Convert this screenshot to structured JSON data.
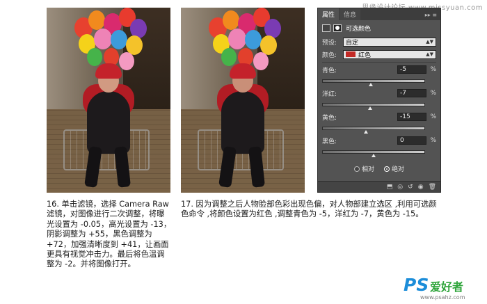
{
  "watermark_top": "思缘设计论坛 www.missyuan.com",
  "panel": {
    "tabs": [
      "属性",
      "信息"
    ],
    "tab_tools": "▸▸ ≡",
    "title": "可选颜色",
    "preset_label": "预设:",
    "preset_value": "自定",
    "colors_label": "颜色:",
    "colors_value": "红色",
    "colors_swatch": "#c32a26",
    "sliders": [
      {
        "name": "青色:",
        "value": "-5",
        "unit": "%",
        "level": -5
      },
      {
        "name": "洋红:",
        "value": "-7",
        "unit": "%",
        "level": -7
      },
      {
        "name": "黄色:",
        "value": "-15",
        "unit": "%",
        "level": -15
      },
      {
        "name": "黑色:",
        "value": "0",
        "unit": "%",
        "level": 0
      }
    ],
    "method_relative": "相对",
    "method_absolute": "绝对",
    "method_selected": "absolute"
  },
  "captions": {
    "left": "16. 单击滤镜，选择 Camera Raw 滤镜，对图像进行二次调整，将曝光设置为 -0.05，高光设置为 -13，阴影调整为 +55，黑色调整为 +72，加强清晰度到 +41，让画面更具有视觉冲击力。最后将色温调整为 -2。并将图像打开。",
    "right": "17. 因为调整之后人物脸部色彩出现色偏，对人物部建立选区 ,利用可选颜色命令 ,将颜色设置为红色 ,调整青色为 -5，洋红为 -7，黄色为 -15。"
  },
  "logo": {
    "ps": "PS",
    "name": "爱好者",
    "url": "www.psahz.com"
  },
  "colors": {
    "panel_bg": "#535353",
    "accent_red": "#c32a26"
  }
}
